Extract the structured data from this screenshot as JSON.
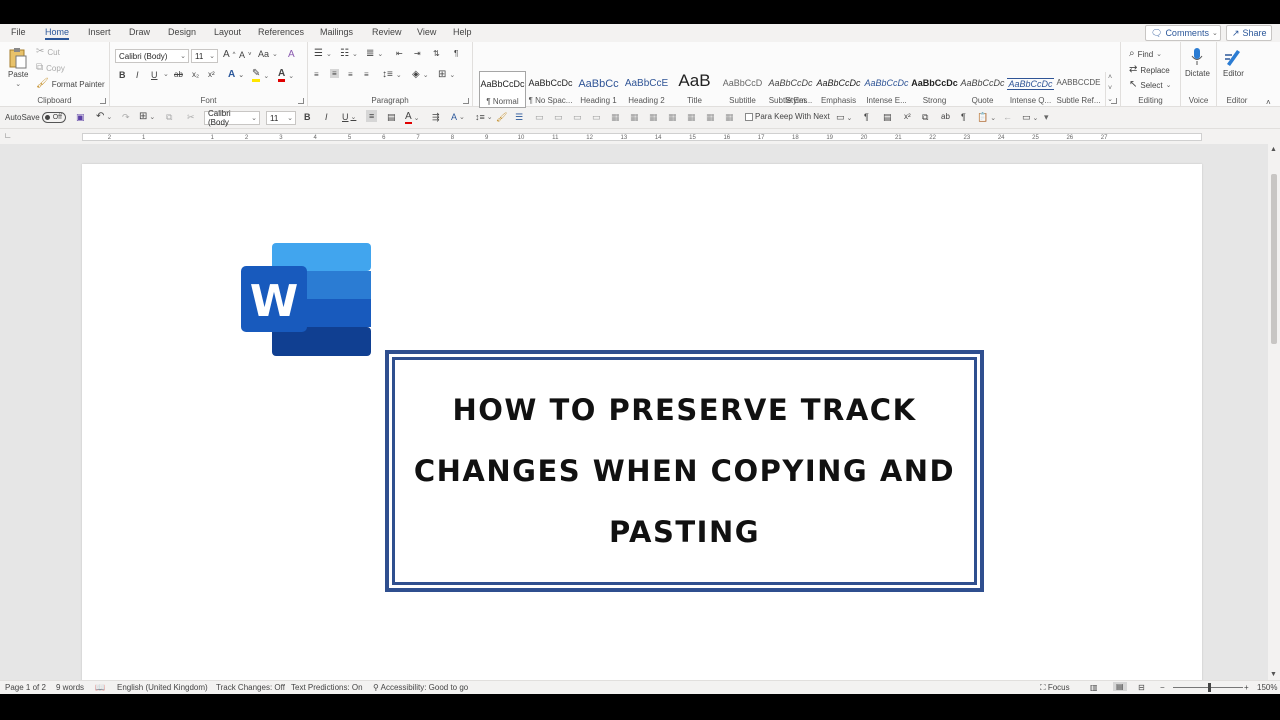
{
  "tabs": [
    "File",
    "Home",
    "Insert",
    "Draw",
    "Design",
    "Layout",
    "References",
    "Mailings",
    "Review",
    "View",
    "Help"
  ],
  "active_tab": "Home",
  "header_buttons": {
    "comments": "Comments",
    "share": "Share"
  },
  "ribbon": {
    "clipboard": {
      "label": "Clipboard",
      "paste": "Paste",
      "cut": "Cut",
      "copy": "Copy",
      "format_painter": "Format Painter"
    },
    "font": {
      "label": "Font",
      "font_name": "Calibri (Body)",
      "font_size": "11",
      "bold": "B",
      "italic": "I",
      "underline": "U",
      "strike": "ab",
      "subscript": "x₂",
      "superscript": "x²",
      "case": "Aa"
    },
    "paragraph": {
      "label": "Paragraph"
    },
    "styles": {
      "label": "Styles",
      "items": [
        {
          "preview": "AaBbCcDc",
          "name": "¶ Normal"
        },
        {
          "preview": "AaBbCcDc",
          "name": "¶ No Spac..."
        },
        {
          "preview": "AaBbCc",
          "name": "Heading 1"
        },
        {
          "preview": "AaBbCcE",
          "name": "Heading 2"
        },
        {
          "preview": "AaB",
          "name": "Title"
        },
        {
          "preview": "AaBbCcD",
          "name": "Subtitle"
        },
        {
          "preview": "AaBbCcDc",
          "name": "Subtle Em..."
        },
        {
          "preview": "AaBbCcDc",
          "name": "Emphasis"
        },
        {
          "preview": "AaBbCcDc",
          "name": "Intense E..."
        },
        {
          "preview": "AaBbCcDc",
          "name": "Strong"
        },
        {
          "preview": "AaBbCcDc",
          "name": "Quote"
        },
        {
          "preview": "AaBbCcDc",
          "name": "Intense Q..."
        },
        {
          "preview": "AABBCCDE",
          "name": "Subtle Ref..."
        }
      ]
    },
    "editing": {
      "label": "Editing",
      "find": "Find",
      "replace": "Replace",
      "select": "Select"
    },
    "voice": {
      "label": "Voice",
      "dictate": "Dictate"
    },
    "editor": {
      "label": "Editor",
      "editor": "Editor"
    }
  },
  "qat": {
    "autosave": "AutoSave",
    "autosave_state": "Off",
    "font_name": "Calibri (Body",
    "font_size": "11",
    "keep_with_next": "Para Keep With Next"
  },
  "ruler_ticks": [
    "2",
    "1",
    "1",
    "2",
    "3",
    "4",
    "5",
    "6",
    "7",
    "8",
    "9",
    "10",
    "11",
    "12",
    "13",
    "14",
    "15",
    "16",
    "17",
    "18",
    "19",
    "20",
    "21",
    "22",
    "23",
    "24",
    "25",
    "26",
    "27"
  ],
  "document": {
    "logo_letter": "W",
    "title": "HOW TO PRESERVE TRACK CHANGES WHEN COPYING AND PASTING"
  },
  "status": {
    "page": "Page 1 of 2",
    "words": "9 words",
    "language": "English (United Kingdom)",
    "track_changes": "Track Changes: Off",
    "text_predictions": "Text Predictions: On",
    "accessibility": "Accessibility: Good to go",
    "focus": "Focus",
    "zoom": "150%"
  },
  "colors": {
    "accent": "#2b579a",
    "frame": "#2f4f8f"
  }
}
